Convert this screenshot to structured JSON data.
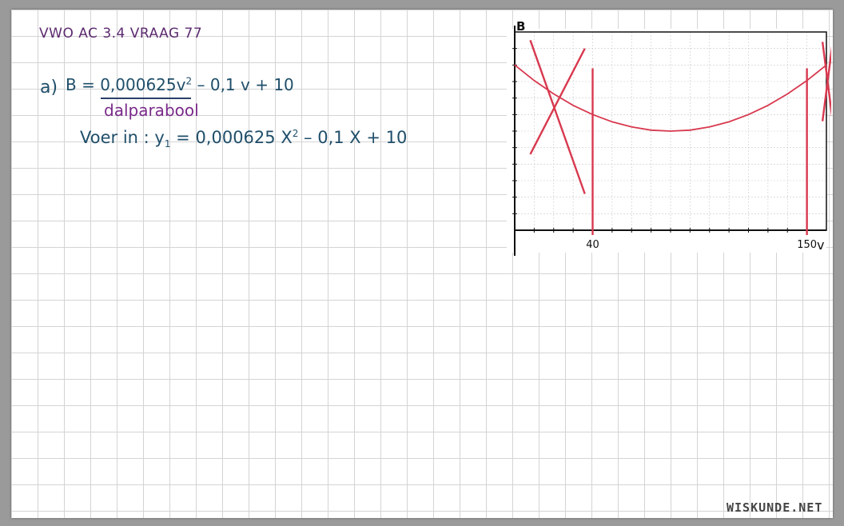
{
  "title": "VWO AC 3.4 VRAAG 77",
  "part_label": "a)",
  "formula": {
    "lhs": "B =",
    "coefficient": "0,000625",
    "var": "v",
    "power": "2",
    "rest": "– 0,1 v + 10"
  },
  "parabola_type": "dalparabool",
  "calculator": {
    "prefix": "Voer in :",
    "y": "y",
    "sub": "1",
    "expr_a": "= 0,000625 X",
    "power": "2",
    "expr_b": "– 0,1 X + 10"
  },
  "chart_data": {
    "type": "line",
    "title": "",
    "xlabel": "v",
    "ylabel": "B",
    "xlim": [
      0,
      160
    ],
    "ylim": [
      0,
      12
    ],
    "tick_labels": [
      "40",
      "150"
    ],
    "series": [
      {
        "x": [
          0,
          10,
          20,
          30,
          40,
          50,
          60,
          70,
          80,
          90,
          100,
          110,
          120,
          130,
          140,
          150,
          160
        ],
        "y": [
          10,
          9.06,
          8.25,
          7.56,
          7.0,
          6.56,
          6.25,
          6.06,
          6.0,
          6.06,
          6.25,
          6.56,
          7.0,
          7.56,
          8.25,
          9.06,
          10
        ]
      }
    ],
    "vertical_lines": [
      40,
      150
    ],
    "crossed_out_regions": [
      "v < 40",
      "v > 150"
    ],
    "grid": true,
    "colors": {
      "curve": "#d8394f",
      "marks": "#d8394f",
      "axes": "#111111"
    }
  },
  "brand": "WISKUNDE.NET"
}
